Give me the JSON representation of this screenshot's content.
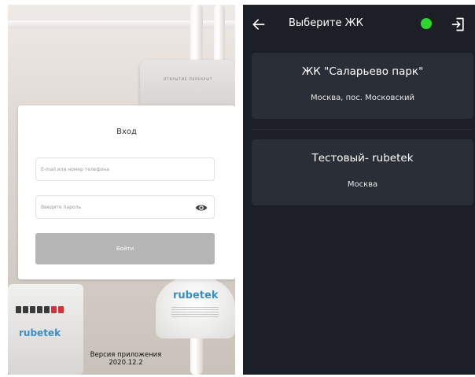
{
  "login": {
    "title": "Вход",
    "email_placeholder": "E-mail или номер телефона",
    "password_placeholder": "Введите пароль",
    "login_button": "Войти",
    "version_label": "Версия приложения",
    "version_number": "2020.12.2",
    "background": {
      "brand": "rubetek",
      "meter_label": "ОТКРЫТИЕ   ПЕРЕКРЫТ"
    }
  },
  "complex_select": {
    "title": "Выберите ЖК",
    "status_color": "#2ed62e",
    "items": [
      {
        "name": "ЖК \"Саларьево парк\"",
        "city": "Москва, пос. Московский"
      },
      {
        "name": "Тестовый-  rubetek",
        "city": "Москва"
      }
    ]
  },
  "icons": {
    "back": "arrow-left-icon",
    "exit": "exit-icon",
    "eye": "eye-icon"
  },
  "colors": {
    "dark_bg": "#1c1f26",
    "card_bg": "#2a2e36",
    "status_online": "#2ed62e",
    "button_disabled": "#b5b5b5",
    "brand_blue": "#3a8fc4"
  }
}
